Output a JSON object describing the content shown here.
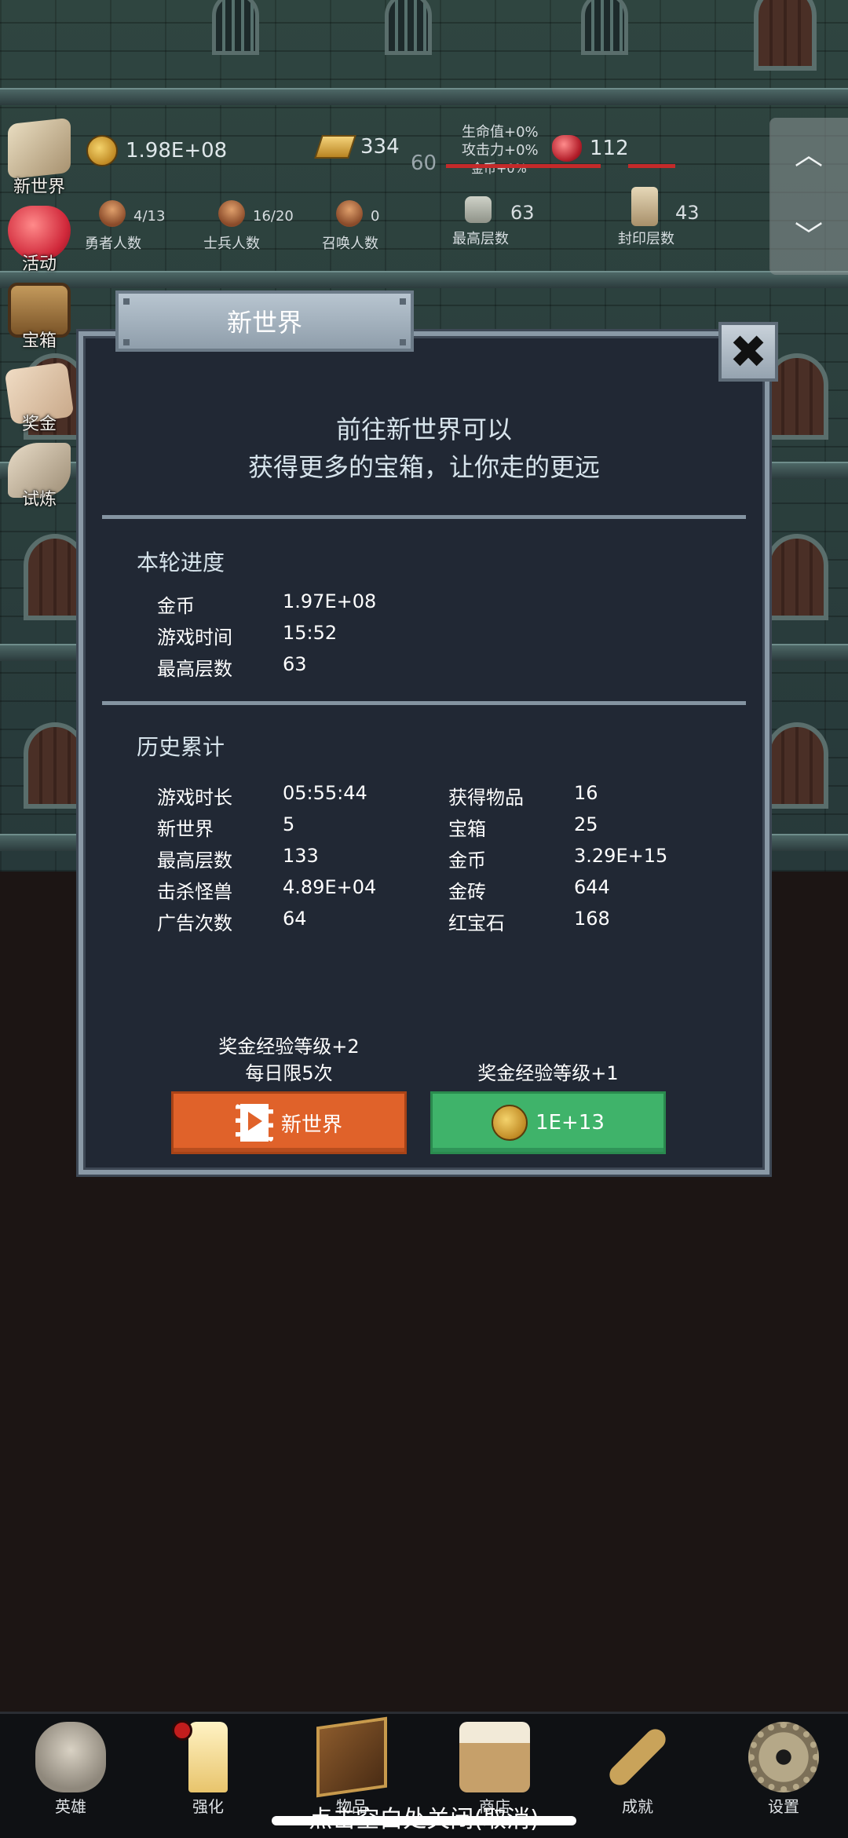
{
  "hud": {
    "gold_value": "1.98E+08",
    "goldbar_value": "334",
    "level_value": "60",
    "ruby_value": "112",
    "bonus_hp": "生命值+0%",
    "bonus_atk": "攻击力+0%",
    "bonus_gold": "金币+0%",
    "heroes_count": "4/13",
    "heroes_label": "勇者人数",
    "soldiers_count": "16/20",
    "soldiers_label": "士兵人数",
    "summon_count": "0",
    "summon_label": "召唤人数",
    "top_floor_count": "63",
    "top_floor_label": "最高层数",
    "sealed_count": "43",
    "sealed_label": "封印层数"
  },
  "side_menu": [
    {
      "label": "新世界",
      "icon": "map-scroll-icon"
    },
    {
      "label": "活动",
      "icon": "heart-icon"
    },
    {
      "label": "宝箱",
      "icon": "treasure-chest-icon"
    },
    {
      "label": "奖金",
      "icon": "envelope-icon"
    },
    {
      "label": "试炼",
      "icon": "feather-icon"
    }
  ],
  "arrows": {
    "up": "︿",
    "down": "﹀"
  },
  "modal": {
    "title": "新世界",
    "close": "✖",
    "intro_line1": "前往新世界可以",
    "intro_line2": "获得更多的宝箱，让你走的更远",
    "current": {
      "heading": "本轮进度",
      "rows": [
        {
          "key": "金币",
          "value": "1.97E+08"
        },
        {
          "key": "游戏时间",
          "value": "15:52"
        },
        {
          "key": "最高层数",
          "value": "63"
        }
      ]
    },
    "history": {
      "heading": "历史累计",
      "left": [
        {
          "key": "游戏时长",
          "value": "05:55:44"
        },
        {
          "key": "新世界",
          "value": "5"
        },
        {
          "key": "最高层数",
          "value": "133"
        },
        {
          "key": "击杀怪兽",
          "value": "4.89E+04"
        },
        {
          "key": "广告次数",
          "value": "64"
        }
      ],
      "right": [
        {
          "key": "获得物品",
          "value": "16"
        },
        {
          "key": "宝箱",
          "value": "25"
        },
        {
          "key": "金币",
          "value": "3.29E+15"
        },
        {
          "key": "金砖",
          "value": "644"
        },
        {
          "key": "红宝石",
          "value": "168"
        }
      ]
    },
    "ad_reward_line1": "奖金经验等级+2",
    "ad_reward_line2": "每日限5次",
    "ad_button_label": "新世界",
    "coin_reward_line": "奖金经验等级+1",
    "coin_button_label": "1E+13"
  },
  "nav": [
    {
      "label": "英雄",
      "icon": "skull-icon"
    },
    {
      "label": "强化",
      "icon": "candle-icon"
    },
    {
      "label": "物品",
      "icon": "book-icon"
    },
    {
      "label": "商店",
      "icon": "beer-mug-icon"
    },
    {
      "label": "成就",
      "icon": "key-icon"
    },
    {
      "label": "设置",
      "icon": "gear-icon"
    }
  ],
  "hint": "点击空白处关闭(取消)",
  "colors": {
    "modal_bg": "#212834",
    "orange_button": "#e0622a",
    "green_button": "#3fb36a",
    "frame": "#8a99a6"
  }
}
